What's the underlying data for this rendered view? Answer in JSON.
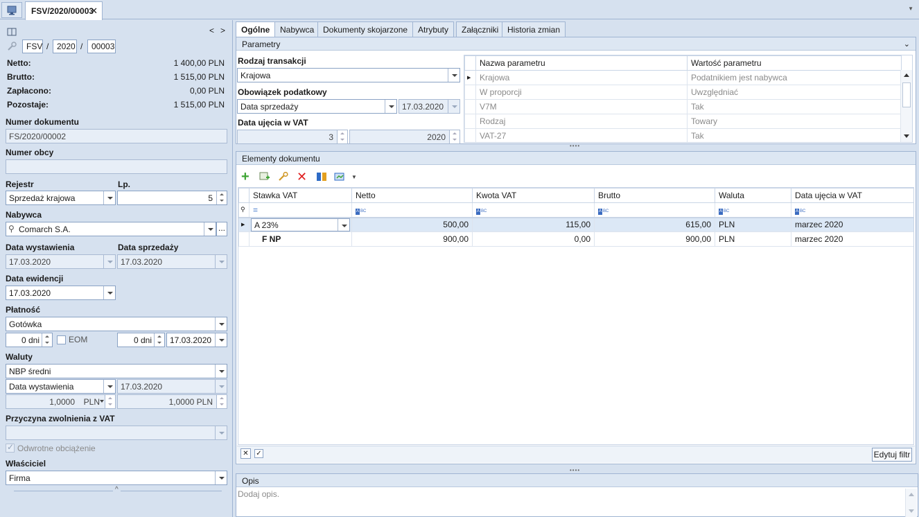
{
  "top": {
    "doc_tab": "FSV/2020/00003",
    "close": "✕"
  },
  "left": {
    "nav_prev": "<",
    "nav_next": ">",
    "series": "FSV",
    "sep1": "/",
    "year": "2020",
    "sep2": "/",
    "number": "00003",
    "netto_label": "Netto:",
    "netto_value": "1 400,00 PLN",
    "brutto_label": "Brutto:",
    "brutto_value": "1 515,00 PLN",
    "zaplacono_label": "Zapłacono:",
    "zaplacono_value": "0,00 PLN",
    "pozostaje_label": "Pozostaje:",
    "pozostaje_value": "1 515,00 PLN",
    "numer_dok_label": "Numer dokumentu",
    "numer_dok_value": "FS/2020/00002",
    "numer_obcy_label": "Numer obcy",
    "numer_obcy_value": "",
    "rejestr_label": "Rejestr",
    "rejestr_value": "Sprzedaż krajowa",
    "lp_label": "Lp.",
    "lp_value": "5",
    "nabywca_label": "Nabywca",
    "nabywca_value": "Comarch S.A.",
    "nabywca_more": "...",
    "data_wyst_label": "Data wystawienia",
    "data_wyst_value": "17.03.2020",
    "data_sprz_label": "Data sprzedaży",
    "data_sprz_value": "17.03.2020",
    "data_ewid_label": "Data ewidencji",
    "data_ewid_value": "17.03.2020",
    "platnosc_label": "Płatność",
    "platnosc_value": "Gotówka",
    "dni1": "0 dni",
    "eom_label": "EOM",
    "dni2": "0 dni",
    "termin": "17.03.2020",
    "waluty_label": "Waluty",
    "kurs_typ": "NBP średni",
    "kurs_data_typ": "Data wystawienia",
    "kurs_data": "17.03.2020",
    "kurs_val": "1,0000",
    "kurs_waluta": "PLN",
    "kurs_val2": "1,0000 PLN",
    "przyczyna_label": "Przyczyna zwolnienia z VAT",
    "przyczyna_value": "",
    "odwrotne_label": "Odwrotne obciążenie",
    "wlasciciel_label": "Właściciel",
    "wlasciciel_value": "Firma"
  },
  "tabs": [
    "Ogólne",
    "Nabywca",
    "Dokumenty skojarzone",
    "Atrybuty",
    "Załączniki",
    "Historia zmian"
  ],
  "parametry": {
    "title": "Parametry",
    "rodzaj_label": "Rodzaj transakcji",
    "rodzaj_value": "Krajowa",
    "obowiazek_label": "Obowiązek podatkowy",
    "obowiazek_value": "Data sprzedaży",
    "obowiazek_date": "17.03.2020",
    "vat_label": "Data ujęcia w VAT",
    "vat_month": "3",
    "vat_year": "2020",
    "headers": [
      "Nazwa parametru",
      "Wartość parametru"
    ],
    "rows": [
      [
        "Krajowa",
        "Podatnikiem jest nabywca"
      ],
      [
        "W proporcji",
        "Uwzględniać"
      ],
      [
        "V7M",
        "Tak"
      ],
      [
        "Rodzaj",
        "Towary"
      ],
      [
        "VAT-27",
        "Tak"
      ]
    ]
  },
  "elementy": {
    "title": "Elementy dokumentu",
    "headers": [
      "Stawka VAT",
      "Netto",
      "Kwota VAT",
      "Brutto",
      "Waluta",
      "Data ujęcia w VAT"
    ],
    "filter_eq": "=",
    "rows": [
      [
        "A 23%",
        "500,00",
        "115,00",
        "615,00",
        "PLN",
        "marzec 2020"
      ],
      [
        "F NP",
        "900,00",
        "0,00",
        "900,00",
        "PLN",
        "marzec 2020"
      ]
    ],
    "edit_filter": "Edytuj filtr"
  },
  "opis": {
    "title": "Opis",
    "placeholder": "Dodaj opis."
  },
  "colors": {
    "accent": "#2e6bc6",
    "bg": "#d6e1ef",
    "border": "#9fb4d2",
    "selected_row": "#dce8f6"
  }
}
